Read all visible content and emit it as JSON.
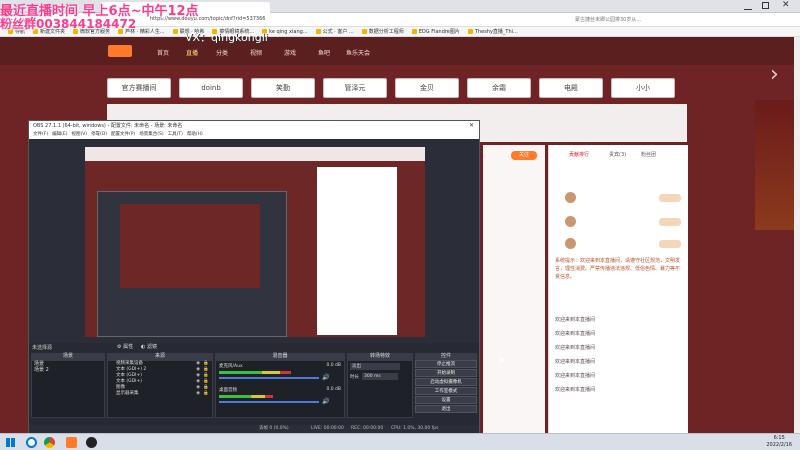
{
  "overlay": {
    "line1": "最近直播时间 早上6点~中午12点",
    "line2": "粉丝群003844184472",
    "line3": "VX：qingkongli"
  },
  "browser": {
    "url": "https://www.douyu.com/topic/dnf?rid=537366",
    "search_hint": "蒙古捷丝未卿公园排30岁从...",
    "bookmarks": [
      "导航",
      "新建文件夹",
      "微软官方服务",
      "芦林 · 精彩人生...",
      "联想 · 哈希",
      "菜情眼镜系统...",
      "ke qing xiang...",
      "公式 · 客户 ...",
      "数据分析工程师",
      "EDG Flandre图片",
      "Theshy直播_Thi..."
    ]
  },
  "site": {
    "nav": [
      "首页",
      "直播",
      "分类",
      "视频",
      "游戏",
      "鱼吧",
      "鱼乐天会"
    ],
    "active_nav": "直播",
    "tags": [
      "官方赛播间",
      "doinb",
      "笑勤",
      "管泽元",
      "金贝",
      "余霜",
      "电殿",
      "小小"
    ],
    "follow_btn": "关注",
    "chat_rank_title": "贡献排行",
    "chat_tabs": [
      "贵宾(3)",
      "粉丝团"
    ],
    "chat_notice": "系统提示：欢迎来到本直播间，请遵守社区规范，文明发言，理性消费。严禁传播违法违规、低俗色情、暴力等不良信息。",
    "chat_messages": [
      "欢迎来到本直播间",
      "欢迎来到本直播间",
      "欢迎来到本直播间",
      "欢迎来到本直播间",
      "欢迎来到本直播间",
      "欢迎来到本直播间"
    ]
  },
  "obs": {
    "title": "OBS 27.1.1 (64-bit, windows) - 配置文件: 未命名 - 场景: 未命名",
    "menu": [
      "文件(F)",
      "编辑(E)",
      "视图(V)",
      "停靠(D)",
      "配置文件(P)",
      "场景集合(S)",
      "工具(T)",
      "帮助(H)"
    ],
    "docks": {
      "scenes": "场景",
      "sources": "来源",
      "mixer": "混音器",
      "transitions": "转场特效",
      "controls": "控件"
    },
    "scene_header": "未选择源",
    "props_btn": "属性",
    "filter_btn": "滤镜",
    "scene_list": [
      "场景",
      "场景 2"
    ],
    "sources_list": [
      "视频采集设备",
      "文本 (GDI+) 2",
      "文本 (GDI+)",
      "文本 (GDI+)",
      "图像",
      "显示器采集"
    ],
    "mixer_tracks": [
      {
        "name": "麦克风/Aux",
        "db": "0.0 dB",
        "level": 0.6
      },
      {
        "name": "桌面音频",
        "db": "0.0 dB",
        "level": 0.45
      }
    ],
    "transition_type": "淡出",
    "duration_label": "时长",
    "duration_value": "300 ms",
    "controls": [
      "停止推流",
      "开始录制",
      "启动虚拟摄像机",
      "工作室模式",
      "设置",
      "退出"
    ],
    "status": {
      "drop": "丢帧 0 (0.0%)",
      "live": "LIVE: 00:00:00",
      "rec": "REC: 00:00:00",
      "cpu": "CPU: 1.0%, 30.00 fps"
    }
  },
  "taskbar": {
    "time": "6:15",
    "date": "2022/2/16"
  },
  "colors": {
    "overlay_text": "#ff3c8c",
    "site_bg": "#6e2424",
    "obs_bg": "#2b2e38"
  }
}
